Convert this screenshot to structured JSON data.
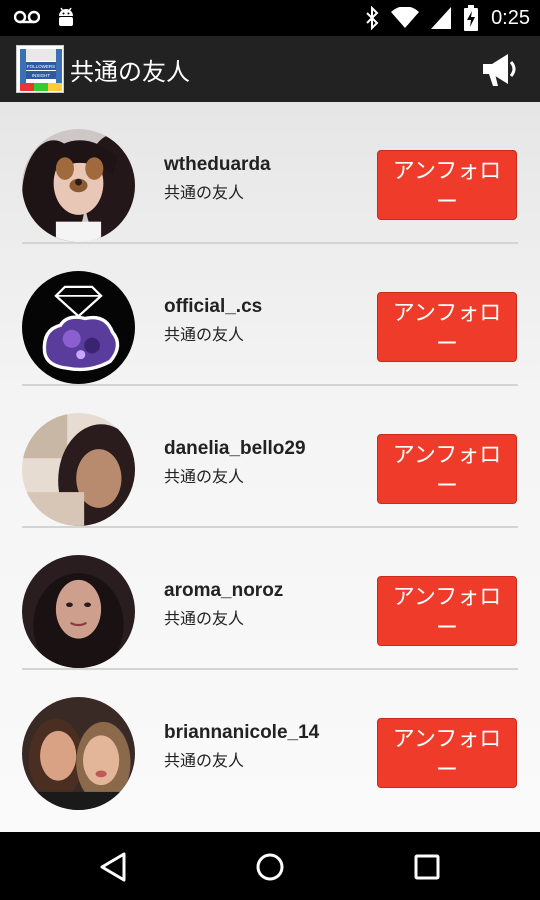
{
  "status_bar": {
    "time": "0:25",
    "icons": [
      "voicemail-icon",
      "android-icon",
      "bluetooth-icon",
      "wifi-icon",
      "signal-icon",
      "battery-charging-icon"
    ]
  },
  "app_bar": {
    "title": "共通の友人",
    "logo_lines": [
      "FOLLOWERS",
      "INSIGHT"
    ],
    "action_icon": "megaphone-icon"
  },
  "friends": [
    {
      "username": "wtheduarda",
      "subtitle": "共通の友人",
      "button_label": "アンフォロー"
    },
    {
      "username": "official_.cs",
      "subtitle": "共通の友人",
      "button_label": "アンフォロー"
    },
    {
      "username": "danelia_bello29",
      "subtitle": "共通の友人",
      "button_label": "アンフォロー"
    },
    {
      "username": "aroma_noroz",
      "subtitle": "共通の友人",
      "button_label": "アンフォロー"
    },
    {
      "username": "briannanicole_14",
      "subtitle": "共通の友人",
      "button_label": "アンフォロー"
    }
  ],
  "nav_bar": {
    "icons": [
      "back-icon",
      "home-icon",
      "recents-icon"
    ]
  },
  "colors": {
    "accent": "#ee3b2a",
    "app_bar": "#222222",
    "background": "#f0f0f0"
  }
}
